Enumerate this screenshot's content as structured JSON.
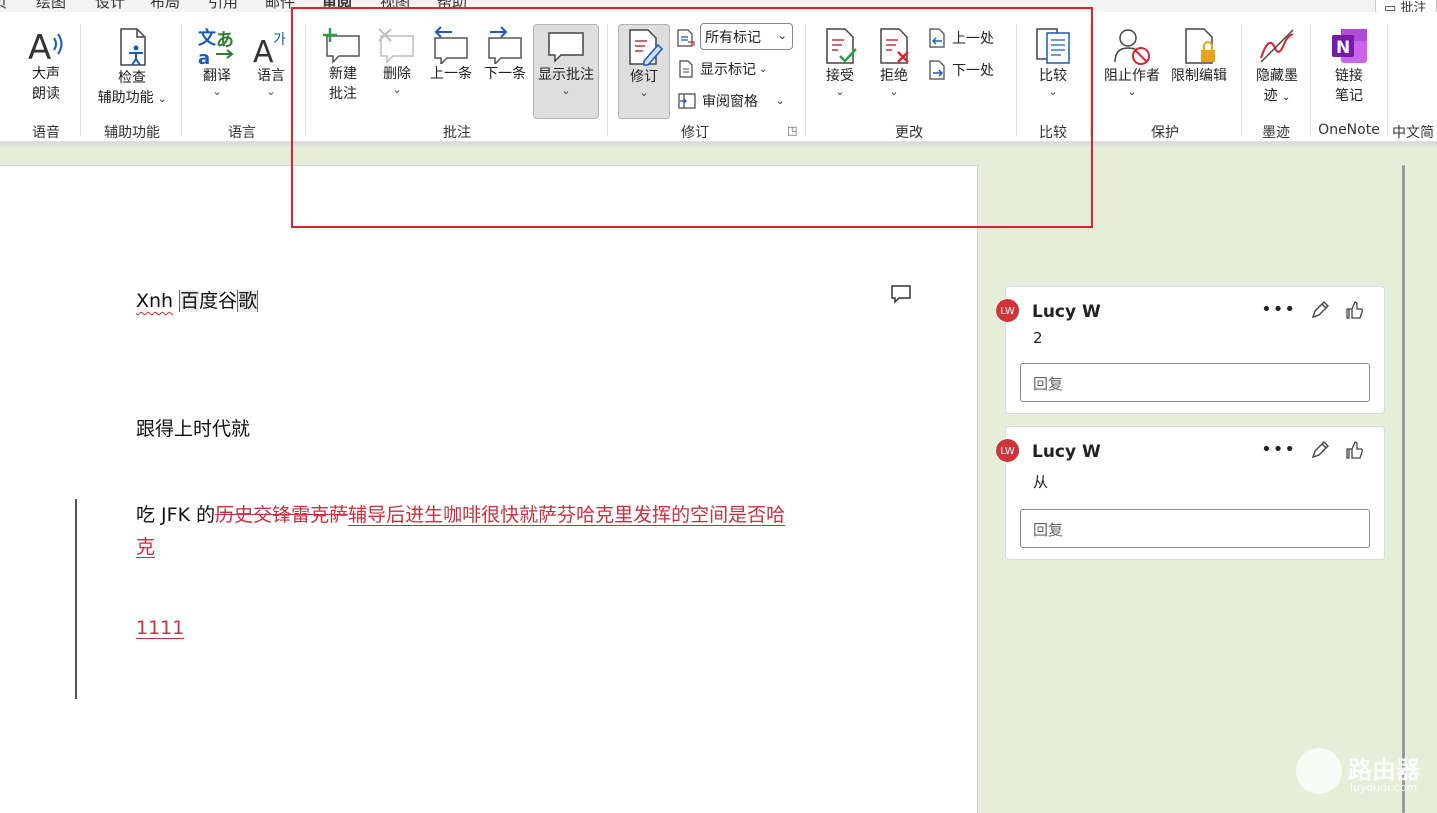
{
  "tabs": {
    "items": [
      "页",
      "绘图",
      "设计",
      "布局",
      "引用",
      "邮件",
      "审阅",
      "视图",
      "帮助"
    ],
    "active_index": 6,
    "topright_label": "批注"
  },
  "ribbon": {
    "speech": {
      "read_aloud": [
        "大声",
        "朗读"
      ],
      "group": "语音"
    },
    "accessibility": {
      "check": [
        "检查",
        "辅助功能"
      ],
      "group": "辅助功能"
    },
    "language": {
      "translate": "翻译",
      "language": "语言",
      "group": "语言"
    },
    "comments": {
      "new": [
        "新建",
        "批注"
      ],
      "delete": "删除",
      "previous": "上一条",
      "next": "下一条",
      "show": "显示批注",
      "group": "批注"
    },
    "tracking": {
      "track_changes": "修订",
      "markup_select": "所有标记",
      "show_markup": "显示标记",
      "reviewing_pane": "审阅窗格",
      "group": "修订"
    },
    "changes": {
      "accept": "接受",
      "reject": "拒绝",
      "previous": "上一处",
      "next": "下一处",
      "group": "更改"
    },
    "compare": {
      "compare": "比较",
      "group": "比较"
    },
    "protect": {
      "block_authors": "阻止作者",
      "restrict_editing": "限制编辑",
      "group": "保护"
    },
    "ink": {
      "hide_ink": [
        "隐藏墨",
        "迹"
      ],
      "group": "墨迹"
    },
    "onenote": {
      "linked_notes": [
        "链接",
        "笔记"
      ],
      "group": "OneNote"
    },
    "chinese": {
      "group": "中文简"
    }
  },
  "document": {
    "line1": {
      "word1": "Xnh",
      "word2": "百",
      "rest": "度谷",
      "word3": "歌"
    },
    "line2": "跟得上时代就",
    "line3": {
      "plain": "吃 JFK 的",
      "deleted": "历史交锋雷克萨",
      "inserted": "辅导后进生咖啡很快就萨芬哈克里发挥的空间是否哈",
      "inserted_wrap": "克"
    },
    "line4": "1111"
  },
  "comments": [
    {
      "initials": "LW",
      "author": "Lucy W",
      "text": "2",
      "reply_placeholder": "回复"
    },
    {
      "initials": "LW",
      "author": "Lucy W",
      "text": "从",
      "reply_placeholder": "回复"
    }
  ],
  "watermark": {
    "text": "路由器",
    "sub": "luyouqi.com"
  },
  "colors": {
    "accent": "#185abd",
    "highlight": "#d9262e",
    "revision": "#c8303f",
    "pane_bg": "#e6edd9",
    "avatar": "#d13438"
  }
}
